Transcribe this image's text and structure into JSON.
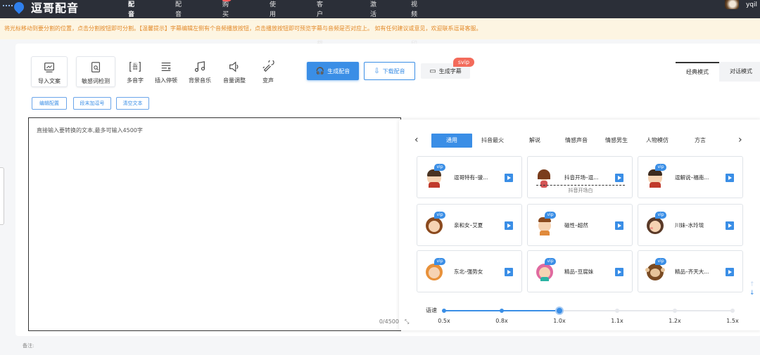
{
  "app": {
    "logo_text": "逗哥配音",
    "colors": {
      "topbar": "#2b2f38",
      "accent": "#3a8ee6",
      "notice_text": "#e38a2a",
      "svip": "#f36b5b"
    }
  },
  "nav": {
    "items": [
      {
        "label": "配音制作",
        "active": true
      },
      {
        "label": "配音样例"
      },
      {
        "label": "购买会员",
        "badge": true
      },
      {
        "label": "使用帮助"
      },
      {
        "label": "客户端下载"
      },
      {
        "label": "激活码"
      },
      {
        "label": "视频去水印"
      }
    ]
  },
  "user": {
    "name": "yqil"
  },
  "notice": {
    "text": "将光标移动到要分割的位置，点击分割按钮即可分割。【温馨提示】字幕编辑左侧有个音频播放按钮，点击播放按钮即可预览字幕与音频是否对应上。 如有任何建议或意见，欢迎联系逗哥客服。"
  },
  "toolbar": {
    "import": "导入文案",
    "sensitive": "敏感词检测",
    "polyphone": "多音字",
    "pause": "插入停顿",
    "bgm": "背景音乐",
    "volume": "音量调整",
    "voice_change": "变声",
    "generate": "生成配音",
    "download": "下载配音",
    "subtitle": "生成字幕",
    "svip": "svip",
    "icons": [
      "import-icon",
      "search-doc-icon",
      "polyphone-icon",
      "pause-icon",
      "music-icon",
      "volume-icon",
      "voice-change-icon",
      "headphone-icon",
      "download-icon",
      "subtitle-icon"
    ]
  },
  "modes": {
    "classic": "经典模式",
    "dialog": "对话模式"
  },
  "actions": {
    "edit_config": "编辑配置",
    "add_period": "段末加逗号",
    "clear": "清空文本"
  },
  "editor": {
    "placeholder": "直接输入要转换的文本,最多可输入4500字",
    "count": "0/4500"
  },
  "categories": [
    "通用",
    "抖音最火",
    "解说",
    "情感声音",
    "情感男生",
    "人物模仿",
    "方言"
  ],
  "voices": [
    {
      "name": "逗哥特有–骏...",
      "vip": true
    },
    {
      "name": "抖音开场–逗...",
      "vip": false,
      "sub": "抖音开场白"
    },
    {
      "name": "逗解说–福南...",
      "vip": true
    },
    {
      "name": "亲和女–艾夏",
      "vip": true
    },
    {
      "name": "磁性–超然",
      "vip": true
    },
    {
      "name": "川妹–水玲珑",
      "vip": true
    },
    {
      "name": "东北–强势女",
      "vip": true
    },
    {
      "name": "精品–豆腐妹",
      "vip": true
    },
    {
      "name": "精品–齐天大...",
      "vip": true
    }
  ],
  "vip_label": "vip",
  "speed": {
    "label": "语速",
    "ticks": [
      "0.5x",
      "0.8x",
      "1.0x",
      "1.1x",
      "1.2x",
      "1.5x"
    ],
    "value": "1.0x"
  },
  "remark": "备注:"
}
